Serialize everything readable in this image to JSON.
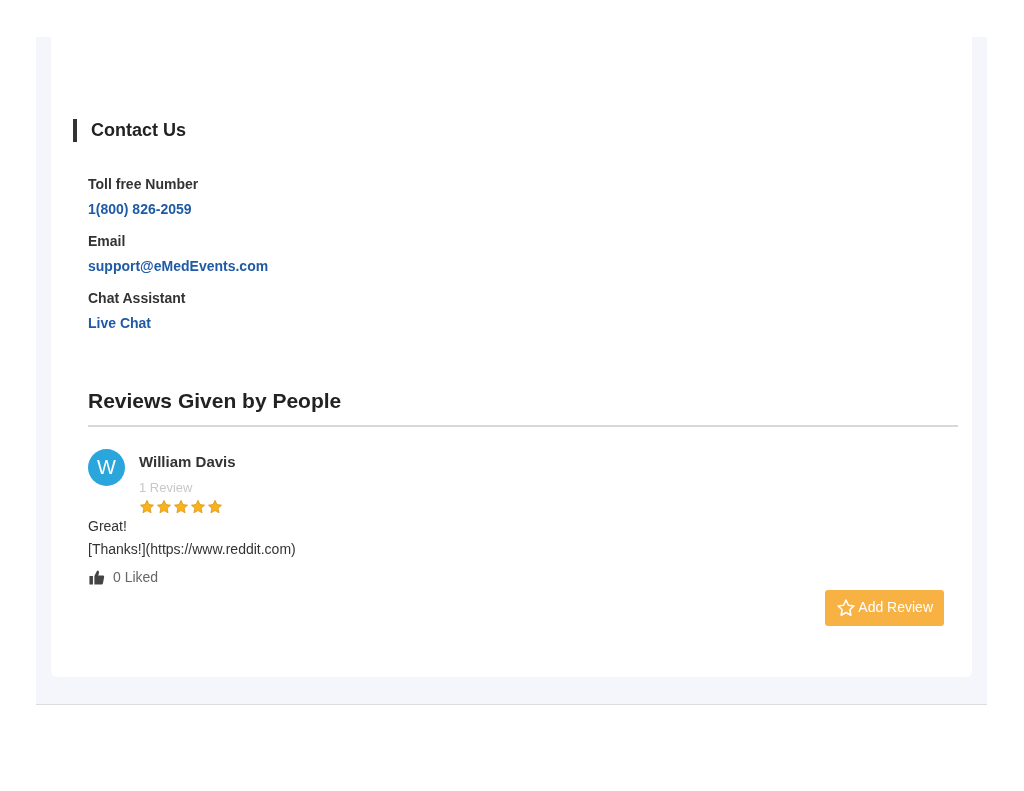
{
  "contact": {
    "title": "Contact Us",
    "items": [
      {
        "label": "Toll free Number",
        "value": "1(800) 826-2059"
      },
      {
        "label": "Email",
        "value": "support@eMedEvents.com"
      },
      {
        "label": "Chat Assistant",
        "value": "Live Chat"
      }
    ]
  },
  "reviews": {
    "title": "Reviews Given by People",
    "items": [
      {
        "avatar": "W",
        "name": "William Davis",
        "count": "1 Review",
        "stars": 5,
        "text": [
          "Great!",
          "[Thanks!](https://www.reddit.com)"
        ],
        "likes": "0 Liked"
      }
    ],
    "add_button": "Add Review"
  }
}
